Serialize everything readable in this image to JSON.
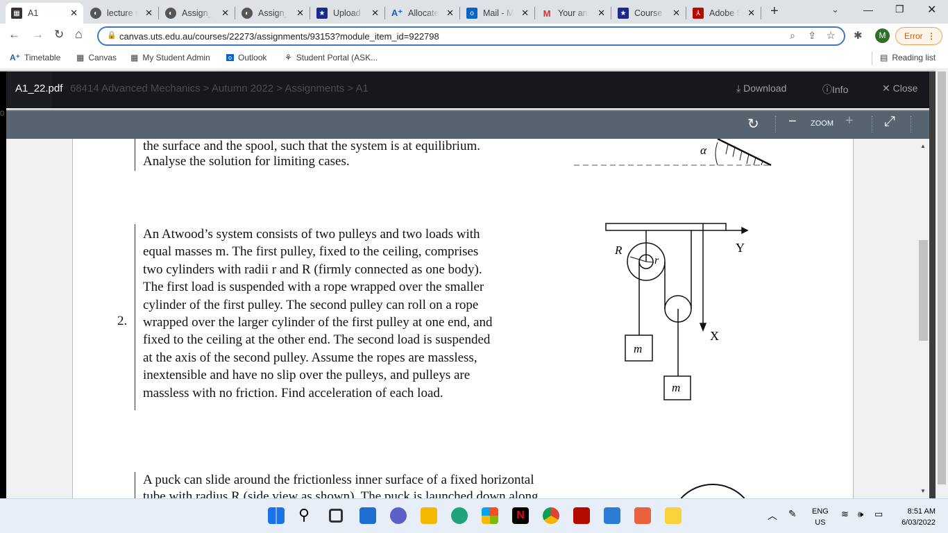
{
  "browser": {
    "tabs": [
      {
        "label": "A1",
        "icon": "uts-icon",
        "active": true
      },
      {
        "label": "lecture n",
        "icon": "globe-icon"
      },
      {
        "label": "Assign_S",
        "icon": "globe-icon"
      },
      {
        "label": "Assign_S",
        "icon": "globe-icon"
      },
      {
        "label": "Upload",
        "icon": "shield-star-icon"
      },
      {
        "label": "Allocate",
        "icon": "allocate-icon"
      },
      {
        "label": "Mail - M",
        "icon": "outlook-icon"
      },
      {
        "label": "Your ans",
        "icon": "gmail-icon"
      },
      {
        "label": "Course",
        "icon": "shield-star-icon"
      },
      {
        "label": "Adobe S",
        "icon": "adobe-icon"
      }
    ],
    "url": "canvas.uts.edu.au/courses/22273/assignments/93153?module_item_id=922798",
    "profile_initial": "M",
    "error_label": "Error",
    "bookmarks": [
      "Timetable",
      "Canvas",
      "My Student Admin",
      "Outlook",
      "Student Portal (ASK..."
    ],
    "reading_list": "Reading list"
  },
  "viewer": {
    "filename": "A1_22.pdf",
    "breadcrumb_bg": "68414 Advanced Mechanics > Autumn 2022 > Assignments > A1",
    "download": "Download",
    "info": "Info",
    "close": "Close",
    "zoom_label": "ZOOM",
    "page_indicator": "0"
  },
  "document": {
    "prev_tail": [
      "the surface and the spool, such that the system is at equilibrium.",
      "Analyse the solution for limiting cases."
    ],
    "alpha_label": "α",
    "problem2_number": "2.",
    "problem2_lines": [
      "An Atwood’s system consists of two pulleys and two loads with",
      "equal masses m. The first pulley, fixed to the ceiling, comprises",
      "two cylinders with radii r and R (firmly connected as one body).",
      "The first load is suspended with a rope wrapped over the smaller",
      "cylinder of the first pulley. The second pulley can roll on a rope",
      "wrapped over the larger cylinder of the first pulley at one end, and",
      "fixed to the ceiling at the other end. The second load is suspended",
      "at the axis of the second pulley. Assume the ropes are massless,",
      "inextensible and have no slip over the pulleys, and pulleys are",
      "massless with no friction. Find acceleration of each load."
    ],
    "diagram": {
      "R": "R",
      "r": "r",
      "Y": "Y",
      "X": "X",
      "m1": "m",
      "m2": "m"
    },
    "problem3_lines": [
      "A puck can slide around the frictionless inner surface of a fixed horizontal",
      "tube with radius R (side view as shown). The puck is launched down along"
    ]
  },
  "taskbar": {
    "lang": "ENG",
    "region": "US",
    "time": "8:51 AM",
    "date": "6/03/2022"
  }
}
